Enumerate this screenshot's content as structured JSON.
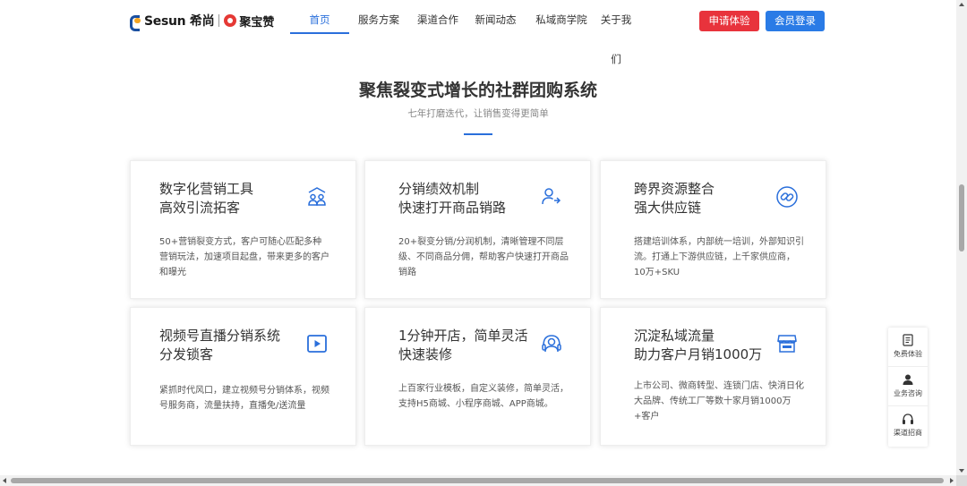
{
  "brand": {
    "logo1": "Sesun 希尚",
    "logo2": "聚宝赞"
  },
  "nav": [
    {
      "label": "首页",
      "active": true
    },
    {
      "label": "服务方案"
    },
    {
      "label": "渠道合作"
    },
    {
      "label": "新闻动态"
    },
    {
      "label": "私域商学院"
    },
    {
      "label": "关于我们"
    }
  ],
  "header_buttons": {
    "trial": "申请体验",
    "login": "会员登录"
  },
  "section": {
    "title": "聚焦裂变式增长的社群团购系统",
    "subtitle": "七年打磨迭代，让销售变得更简单"
  },
  "cards": [
    {
      "title1": "数字化营销工具",
      "title2": "高效引流拓客",
      "icon": "users-group-icon",
      "desc": "50+营销裂变方式，客户可随心匹配多种营销玩法，加速项目起盘，带来更多的客户和曝光"
    },
    {
      "title1": "分销绩效机制",
      "title2": "快速打开商品销路",
      "icon": "user-share-icon",
      "desc": "20+裂变分销/分润机制，清晰管理不同层级、不同商品分佣，帮助客户快速打开商品销路"
    },
    {
      "title1": "跨界资源整合",
      "title2": "强大供应链",
      "icon": "link-icon",
      "desc": "搭建培训体系，内部统一培训，外部知识引流。打通上下游供应链，上千家供应商，10万+SKU"
    },
    {
      "title1": "视频号直播分销系统",
      "title2": "分发锁客",
      "icon": "video-play-icon",
      "desc": "紧抓时代风口，建立视频号分销体系，视频号服务商，流量扶持，直播免/送流量"
    },
    {
      "title1": "1分钟开店，简单灵活",
      "title2": "快速装修",
      "icon": "headset-icon",
      "desc": "上百家行业模板，自定义装修，简单灵活，支持H5商城、小程序商城、APP商城。"
    },
    {
      "title1": "沉淀私域流量",
      "title2": "助力客户月销1000万",
      "icon": "store-icon",
      "desc": "上市公司、微商转型、连锁门店、快消日化大品牌、传统工厂等数十家月销1000万+客户"
    }
  ],
  "float": [
    {
      "label": "免费体验",
      "icon": "document-icon"
    },
    {
      "label": "业务咨询",
      "icon": "user-icon"
    },
    {
      "label": "渠道招商",
      "icon": "headphones-icon"
    }
  ],
  "colors": {
    "accent": "#2a6fdb",
    "trial": "#e8333c",
    "login": "#2a7be6"
  }
}
